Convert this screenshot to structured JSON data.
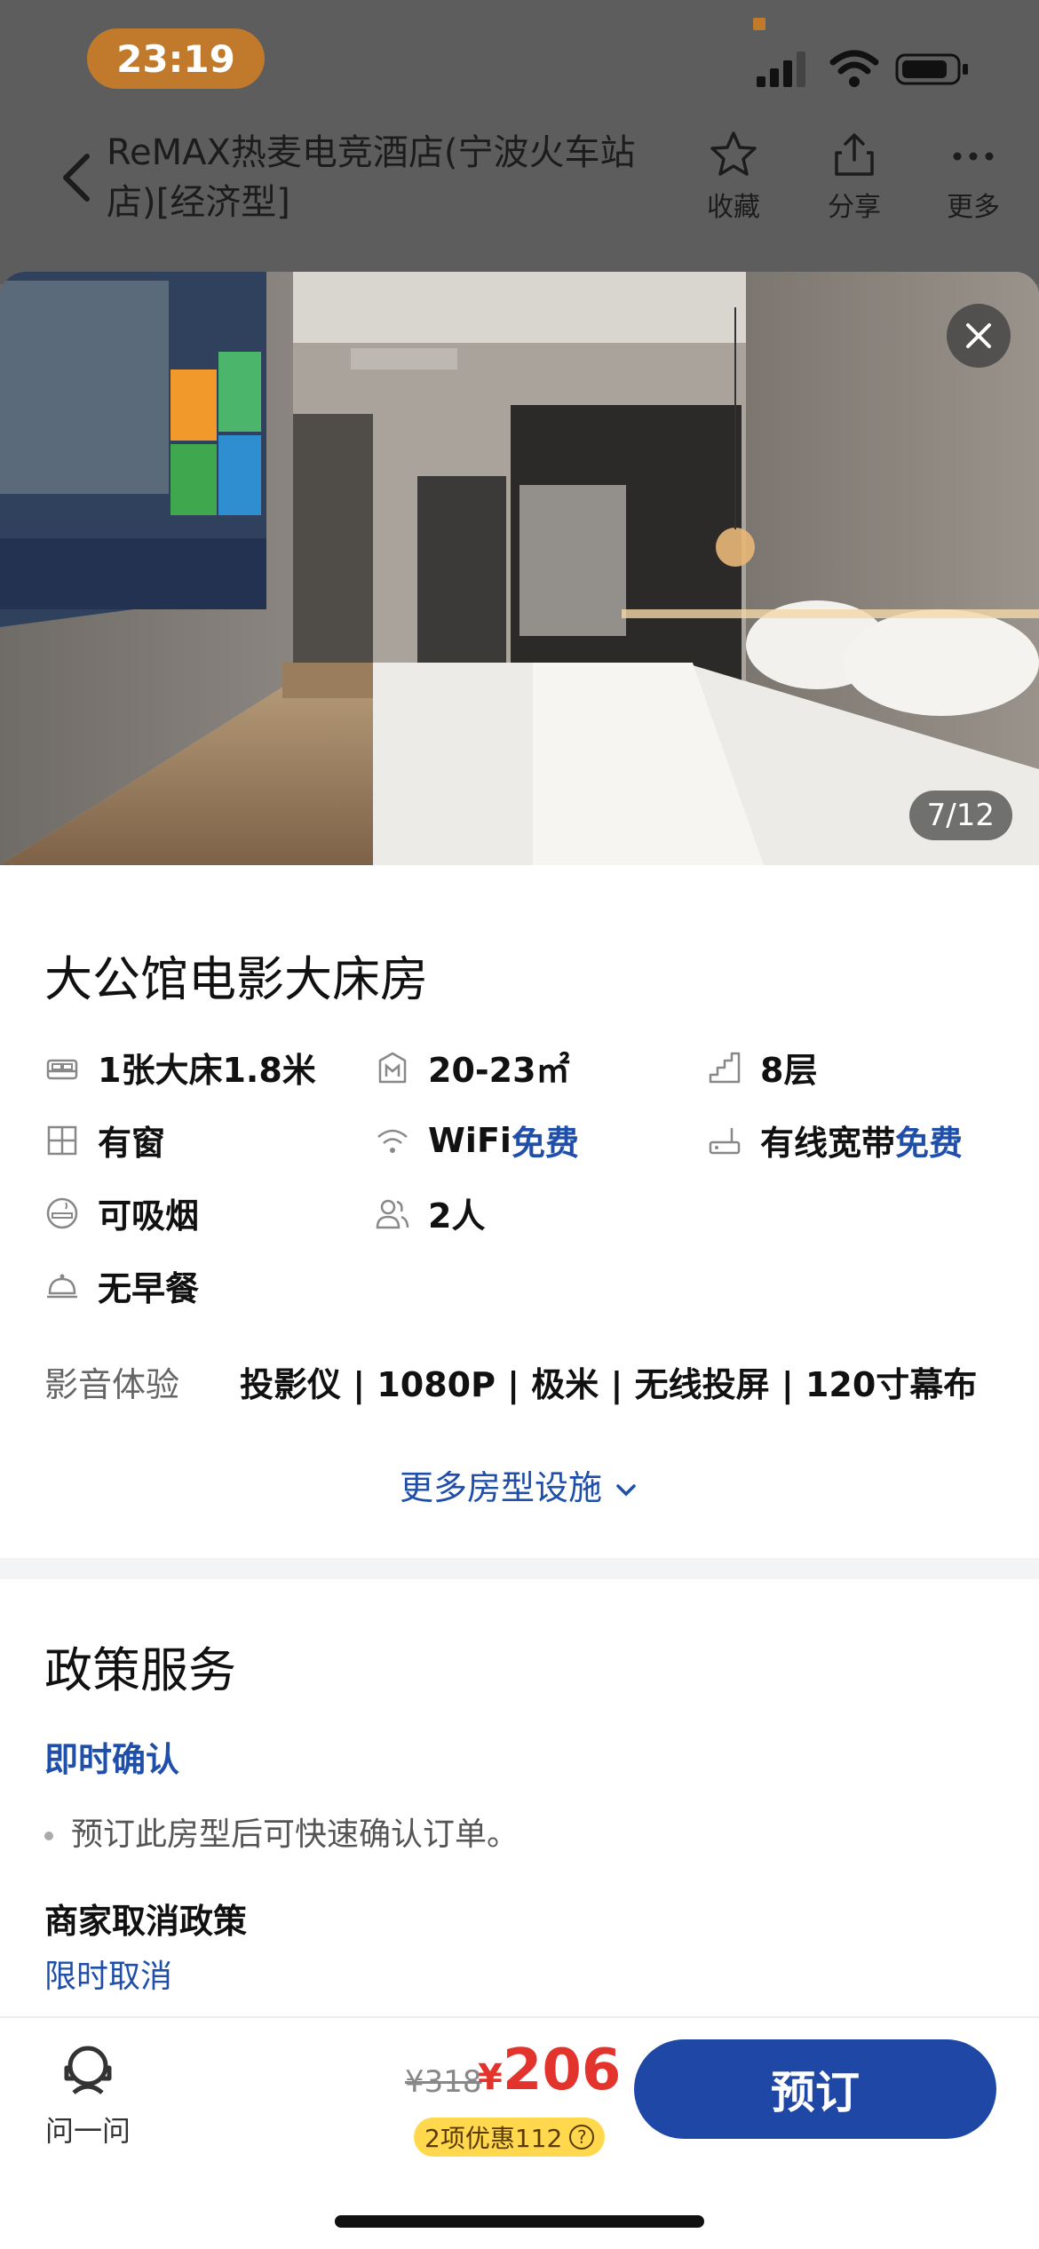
{
  "status_bar": {
    "time": "23:19"
  },
  "header": {
    "hotel_title": "ReMAX热麦电竞酒店(宁波火车站店)[经济型]",
    "actions": [
      {
        "label": "收藏",
        "icon": "star-icon"
      },
      {
        "label": "分享",
        "icon": "share-icon"
      },
      {
        "label": "更多",
        "icon": "more-icon"
      }
    ]
  },
  "photo": {
    "counter": "7/12"
  },
  "room": {
    "name": "大公馆电影大床房",
    "facilities": [
      {
        "icon": "bed-icon",
        "text": "1张大床1.8米"
      },
      {
        "icon": "area-icon",
        "text": "20-23㎡"
      },
      {
        "icon": "floor-icon",
        "text": "8层"
      },
      {
        "icon": "window-icon",
        "text": "有窗"
      },
      {
        "icon": "wifi-icon",
        "text": "WiFi",
        "free": "免费"
      },
      {
        "icon": "broadband-icon",
        "text": "有线宽带",
        "free": "免费"
      },
      {
        "icon": "smoking-icon",
        "text": "可吸烟"
      },
      {
        "icon": "guests-icon",
        "text": "2人"
      },
      {
        "icon": "breakfast-icon",
        "text": "无早餐"
      }
    ],
    "av_label": "影音体验",
    "av_value": "投影仪 | 1080P | 极米 | 无线投屏 | 120寸幕布",
    "more_link": "更多房型设施"
  },
  "policy": {
    "title": "政策服务",
    "confirm_title": "即时确认",
    "confirm_text": "预订此房型后可快速确认订单。",
    "cancel_title": "商家取消政策",
    "cancel_sub": "限时取消"
  },
  "bottom": {
    "ask_label": "问一问",
    "old_price": "¥318",
    "currency": "¥",
    "price": "206",
    "discount": "2项优惠112",
    "book_label": "预订"
  },
  "colors": {
    "accent": "#1f48a6",
    "price": "#e2342d",
    "badge": "#ffd84d"
  }
}
